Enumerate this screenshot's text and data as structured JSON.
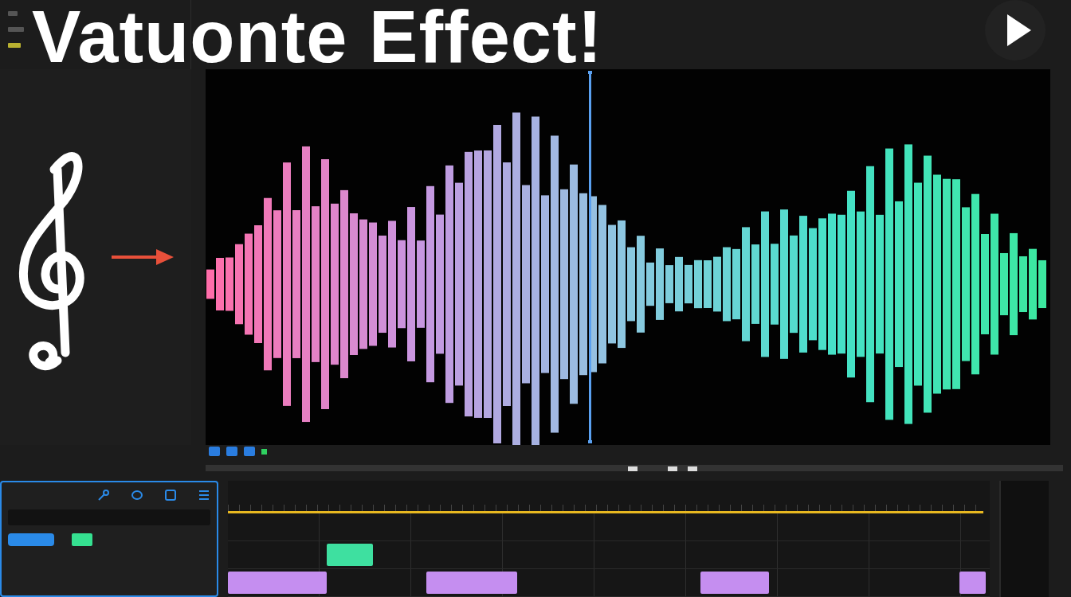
{
  "title": "Vatuonte Effect!",
  "lanes": [
    {
      "clips": [
        {
          "color": "#3ee0a0"
        }
      ]
    },
    {
      "clips": [
        {
          "color": "#c58ef0"
        },
        {
          "color": "#c58ef0"
        },
        {
          "color": "#c58ef0"
        },
        {
          "color": "#c58ef0"
        }
      ]
    }
  ]
}
